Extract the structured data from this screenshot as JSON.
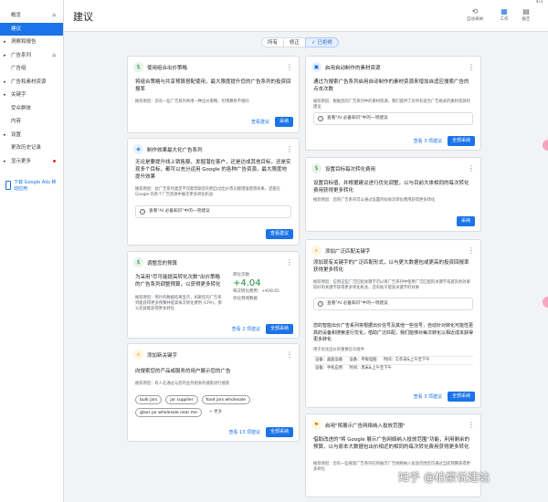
{
  "corner_text": "4/3",
  "header": {
    "title": "建议",
    "actions": [
      {
        "icon": "history-icon",
        "label": "自动采纳"
      },
      {
        "icon": "columns-icon",
        "label": "工作"
      },
      {
        "icon": "report-icon",
        "label": "报告"
      }
    ]
  },
  "sidebar": {
    "items": [
      {
        "label": "概览",
        "arrow": false,
        "home": true,
        "dot": false
      },
      {
        "label": "建议",
        "arrow": false,
        "home": false,
        "dot": false,
        "active": true
      },
      {
        "label": "洞察和报告",
        "arrow": true,
        "home": false,
        "dot": false
      },
      {
        "label": "广告系列",
        "arrow": true,
        "home": true,
        "dot": false
      },
      {
        "label": "广告组",
        "arrow": false,
        "home": false,
        "dot": false
      },
      {
        "label": "广告和素材资源",
        "arrow": true,
        "home": false,
        "dot": false
      },
      {
        "label": "关键字",
        "arrow": true,
        "home": false,
        "dot": false
      },
      {
        "label": "受众群体",
        "arrow": false,
        "home": false,
        "dot": false
      },
      {
        "label": "内容",
        "arrow": false,
        "home": false,
        "dot": false
      },
      {
        "label": "设置",
        "arrow": true,
        "home": false,
        "dot": false
      },
      {
        "label": "更改历史记录",
        "arrow": false,
        "home": false,
        "dot": false
      },
      {
        "label": "显示更多",
        "arrow": true,
        "home": false,
        "dot": true
      }
    ],
    "promo": "下载 Google Ads 移动应用"
  },
  "filters": [
    {
      "label": "所有",
      "on": false
    },
    {
      "label": "修正",
      "on": false
    },
    {
      "label": "✓ 已拒绝",
      "on": true
    }
  ],
  "cards": {
    "c1": {
      "title": "使用组合出价策略",
      "desc": "将组合策略与共享预算搭配使用，最大限度提升您的广告系列的投资回报率",
      "reason": "推荐原因：您有一些广告系列共用一种出价策略，但预算各不相同",
      "link": "查看建议",
      "btn": "采纳"
    },
    "c2": {
      "title": "制作效果最大化广告系列",
      "desc": "无论是要提升线上销售额、发掘潜在客户，还是达成其他目标，还是实现多个目标，都可以充分运用 Google 的各种广告资源，最大限度地提升效果",
      "reason": "推荐原因：此广告系列类型不仅能帮助您利用自动出价等功能增强营销效果，还能在 Google 的各个广告资源中展示更多转化机会",
      "tip": "查看\"AI 必备知识\"中的一项建议",
      "btn": "查看建议"
    },
    "c3": {
      "title": "调整您的预算",
      "desc": "为采用\"尽可能提高转化次数\"出价策略的广告系列调整预算，以获得更多转化",
      "reason": "推荐原因：预计的数据结果显示，如果您的广告系列能获得更多预算并提高每次转化费用 (CPA)，那么您就能获得更多转化",
      "kpi_label": "转化次数",
      "kpi_value": "+4.04",
      "kpi_cost": "每次转化费用：+¥28.65",
      "kpi_note": "优化预测数据",
      "link": "查看 2 项建议",
      "btn": "全部采纳"
    },
    "c4": {
      "title": "添加新关键字",
      "desc": "向搜索您的产品或服务的用户展示您的广告",
      "reason": "推荐原因：有人在通过与您的业务相关的搜索进行搜索",
      "keywords": [
        "bulk jars",
        "jar supplier",
        "food jars wholesale",
        "glass jar wholesale near me",
        "+ 更多"
      ],
      "link": "查看 13 项建议",
      "btn": "全部采纳"
    },
    "c5": {
      "title": "启用自动制作的素材资源",
      "desc": "通过为搜索广告系列启用自动制作的素材资源来增加自适应搜索广告的点击次数",
      "reason": "推荐原因：根据您的广告系列中的素材资源，我们提供了对所有适合广告格式的素材资源的建议",
      "tip": "查看\"AI 必备知识\"中的一项建议",
      "link": "查看 3 项建议",
      "btn": "全部采纳"
    },
    "c6": {
      "title": "设置目标每次转化费用",
      "desc": "设置目标值、并根据建议进行优化调整，以与目前大体相同的每次转化费用获得更多转化",
      "reason": "推荐原因：您的广告系列可以通过设置目标每次转化费用获得更多转化",
      "btn": "采纳"
    },
    "c7": {
      "title": "添加广泛匹配关键字",
      "desc": "添加现有关键字的广泛匹配形式，以与更大数据包或更高的投资回报率获得更多转化",
      "reason": "推荐原因：应用这些广泛匹配关键字可以将广告系列中使用广泛匹配的关键字或者其他效果较好的关键字获得更多转化机会，还有助于提高关键字的效果",
      "tip": "查看\"AI 必备知识\"中的一项建议",
      "desc2": "您的智能出价广告系列将根据出价信号及其他一些信号，自动针对转化可能性更高的设备和搜索进行优化，借助广泛匹配，我们能够对每次转化以相近成本获得更多转化",
      "sub": "用于优化出价的重要信号组件",
      "rows": [
        [
          "设备：桌面设备",
          "设备：平板电脑",
          "时间：工作日&上午至下午"
        ],
        [
          "设备：手机应用",
          "时间：周末&上午至下午"
        ]
      ],
      "link": "查看 3 项建议",
      "btn": "全部采纳"
    },
    "c8": {
      "title": "启用\"将展示广告网络纳入投放范围\"",
      "desc": "借助改进的\"将 Google 展示广告网络纳入投放范围\"功能，利用剩余的预算，以与原本大数据包出价相近的相同的每次转化费用获得更多转化",
      "reason": "推荐原因：您有一些搜索广告系列在将展示广告网络纳入投放范围后可通过当前预算获得更多转化"
    }
  },
  "watermark": "知乎 @柏豪说建站"
}
